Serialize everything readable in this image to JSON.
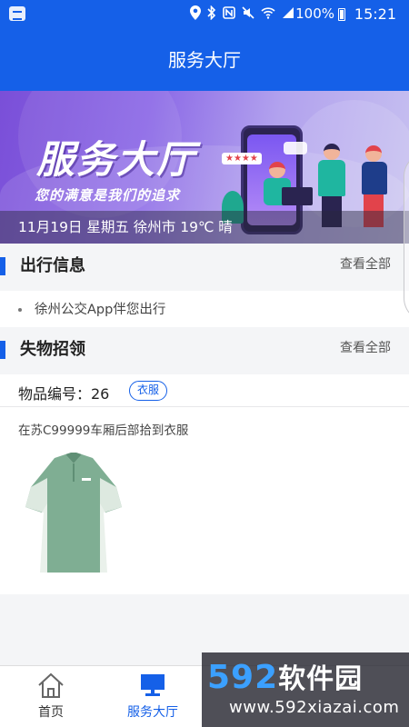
{
  "status_bar": {
    "battery_text": "100%",
    "time": "15:21",
    "icons": [
      "location-icon",
      "bluetooth-icon",
      "nfc-icon",
      "mute-icon",
      "wifi-icon",
      "signal-icon",
      "battery-icon"
    ]
  },
  "header": {
    "title": "服务大厅"
  },
  "banner": {
    "headline": "服务大厅",
    "slogan": "您的满意是我们的追求",
    "rating_stars": "★★★★",
    "weather_line": "11月19日 星期五 徐州市 19℃ 晴"
  },
  "travel_section": {
    "title": "出行信息",
    "more_label": "查看全部",
    "items": [
      {
        "text": "徐州公交App伴您出行"
      }
    ]
  },
  "lost_found_section": {
    "title": "失物招领",
    "more_label": "查看全部",
    "item": {
      "number_label": "物品编号：26",
      "category_tag": "衣服",
      "description": "在苏C99999车厢后部拾到衣服",
      "image": "green-polo-shirt"
    }
  },
  "tab_bar": {
    "tabs": [
      {
        "label": "首页",
        "icon": "home-icon",
        "active": false
      },
      {
        "label": "服务大厅",
        "icon": "monitor-icon",
        "active": true
      }
    ]
  },
  "watermark": {
    "brand_num": "592",
    "brand_cn": "软件园",
    "url": "www.592xiazai.com"
  },
  "colors": {
    "primary": "#1560e8",
    "accent_teal": "#1fb6a0",
    "banner_purple": "#7a4fd8"
  }
}
